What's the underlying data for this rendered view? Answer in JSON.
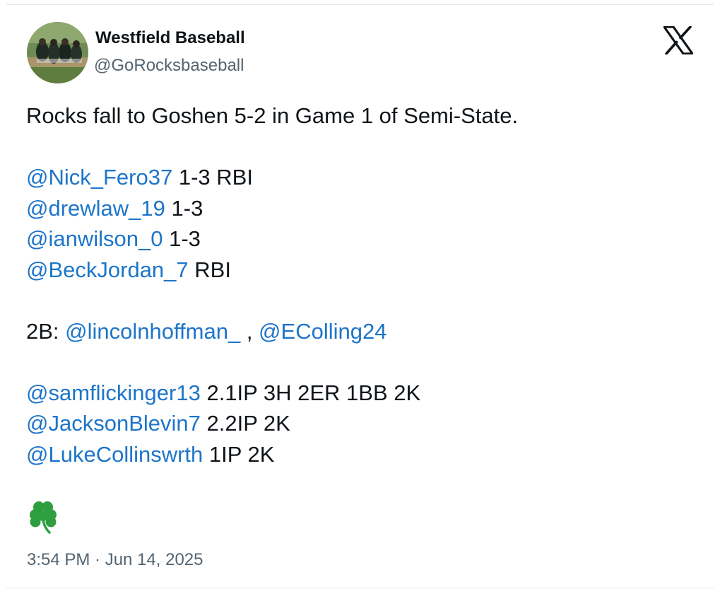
{
  "account": {
    "display_name": "Westfield Baseball",
    "handle": "@GoRocksbaseball"
  },
  "icons": {
    "brand": "x-logo-icon",
    "emoji": "shamrock-icon"
  },
  "tweet": {
    "headline": "Rocks fall to Goshen 5-2 in Game 1 of Semi-State.",
    "batting": [
      {
        "mention": "@Nick_Fero37",
        "stat": " 1-3 RBI"
      },
      {
        "mention": "@drewlaw_19",
        "stat": " 1-3"
      },
      {
        "mention": "@ianwilson_0",
        "stat": " 1-3"
      },
      {
        "mention": "@BeckJordan_7",
        "stat": " RBI"
      }
    ],
    "doubles": {
      "prefix": "2B: ",
      "mention_1": "@lincolnhoffman_",
      "separator": " , ",
      "mention_2": "@EColling24"
    },
    "pitching": [
      {
        "mention": "@samflickinger13",
        "stat": " 2.1IP 3H 2ER 1BB 2K"
      },
      {
        "mention": "@JacksonBlevin7",
        "stat": " 2.2IP 2K"
      },
      {
        "mention": "@LukeCollinswrth",
        "stat": " 1IP 2K"
      }
    ]
  },
  "timestamp": "3:54 PM · Jun 14, 2025",
  "colors": {
    "text": "#0f1419",
    "mention": "#1d75c9",
    "secondary": "#536471",
    "shamrock": "#2e9e3e"
  }
}
